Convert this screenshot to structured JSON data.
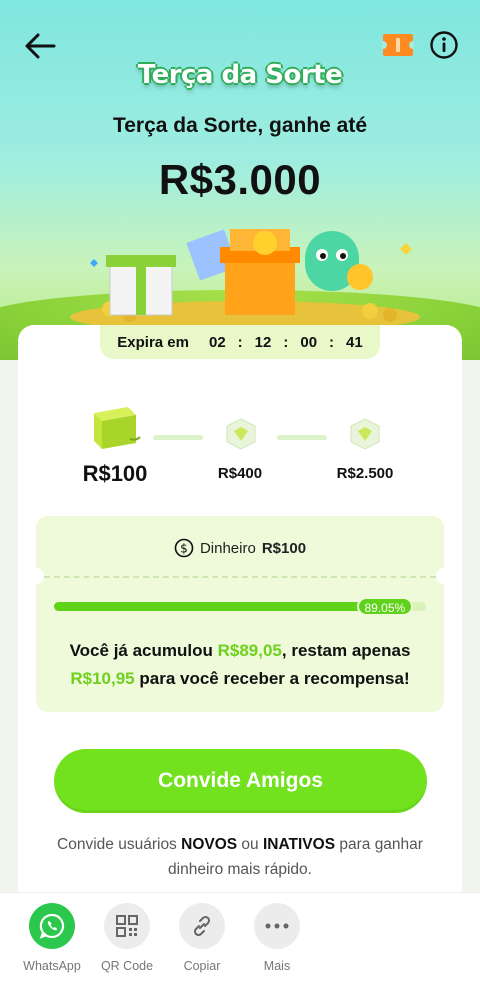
{
  "header": {
    "logo_text": "Terça da Sorte",
    "headline": "Terça da Sorte, ganhe até",
    "max_amount": "R$3.000"
  },
  "timer": {
    "label": "Expira em",
    "days": "02",
    "hours": "12",
    "minutes": "00",
    "seconds": "41",
    "separator": ":"
  },
  "steps": [
    {
      "amount": "R$100",
      "icon": "gift-box-icon",
      "active": true
    },
    {
      "amount": "R$400",
      "icon": "gem-box-icon",
      "active": false
    },
    {
      "amount": "R$2.500",
      "icon": "gem-box-icon",
      "active": false
    }
  ],
  "reward": {
    "type_label": "Dinheiro",
    "value": "R$100",
    "icon": "dollar-coin-icon"
  },
  "progress": {
    "percent": 89.05,
    "badge": "89.05%"
  },
  "message": {
    "part1": "Você já acumulou",
    "accumulated": "R$89,05",
    "part2": ", restam apenas",
    "remaining": "R$10,95",
    "part3": "para você receber a recompensa!"
  },
  "cta": {
    "label": "Convide Amigos"
  },
  "hint": {
    "part1": "Convide usuários",
    "new": "NOVOS",
    "or": "ou",
    "inactive": "INATIVOS",
    "part2": "para ganhar dinheiro mais rápido."
  },
  "share": [
    {
      "label": "WhatsApp",
      "icon": "whatsapp-icon",
      "color": "#2cc84d"
    },
    {
      "label": "QR Code",
      "icon": "qr-code-icon",
      "color": "#ececec"
    },
    {
      "label": "Copiar",
      "icon": "link-icon",
      "color": "#ececec"
    },
    {
      "label": "Mais",
      "icon": "more-icon",
      "color": "#ececec"
    }
  ],
  "colors": {
    "accent_green": "#71e21d",
    "highlight_green": "#6fd01f",
    "progress_green": "#5fd21a"
  }
}
